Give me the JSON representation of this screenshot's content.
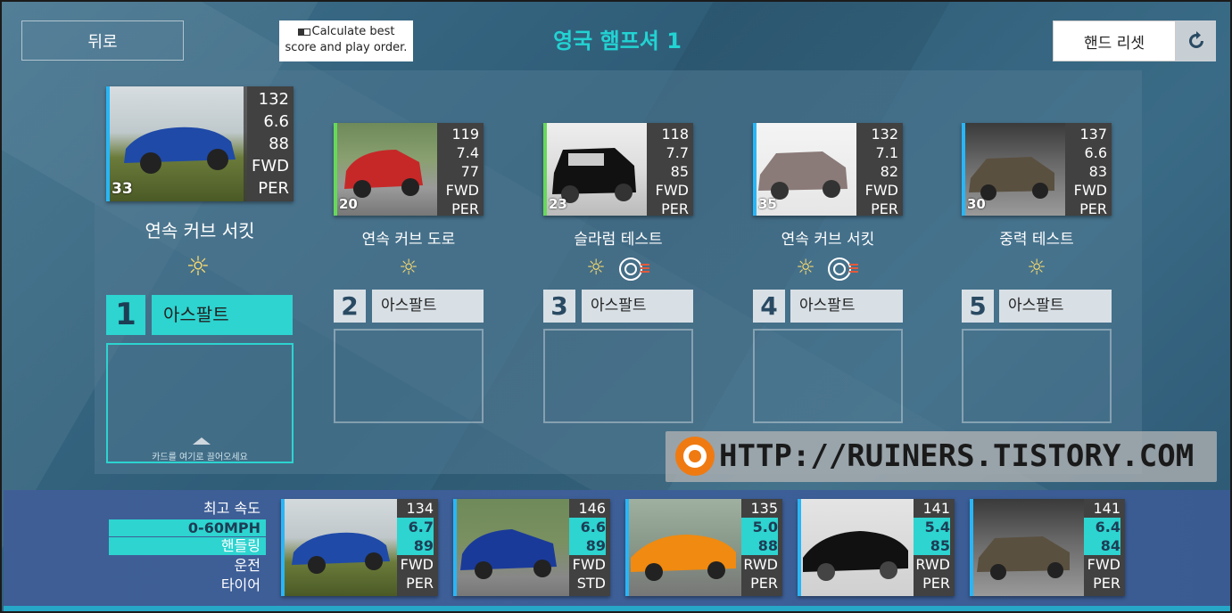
{
  "header": {
    "back_label": "뒤로",
    "calculate_label_1": "Calculate best",
    "calculate_label_2": "score and play order.",
    "title": "영국 햄프셔 1",
    "reset_label": "핸드 리셋"
  },
  "races": [
    {
      "slot": "1",
      "name": "연속 커브 서킷",
      "surface": "아스팔트",
      "weather": "sun-icon",
      "tire_icon": false,
      "card": {
        "rating": "33",
        "top_speed": "132",
        "accel": "6.6",
        "handling": "88",
        "drive": "FWD",
        "tyre": "PER",
        "edge_color": "#29b6f6"
      },
      "drop_hint": "카드를 여기로 끌어오세요"
    },
    {
      "slot": "2",
      "name": "연속 커브 도로",
      "surface": "아스팔트",
      "weather": "sun-icon",
      "tire_icon": false,
      "card": {
        "rating": "20",
        "top_speed": "119",
        "accel": "7.4",
        "handling": "77",
        "drive": "FWD",
        "tyre": "PER",
        "edge_color": "#66d95b"
      }
    },
    {
      "slot": "3",
      "name": "슬라럼 테스트",
      "surface": "아스팔트",
      "weather": "sun-icon",
      "tire_icon": true,
      "card": {
        "rating": "23",
        "top_speed": "118",
        "accel": "7.7",
        "handling": "85",
        "drive": "FWD",
        "tyre": "PER",
        "edge_color": "#66d95b"
      }
    },
    {
      "slot": "4",
      "name": "연속 커브 서킷",
      "surface": "아스팔트",
      "weather": "sun-icon",
      "tire_icon": true,
      "card": {
        "rating": "35",
        "top_speed": "132",
        "accel": "7.1",
        "handling": "82",
        "drive": "FWD",
        "tyre": "PER",
        "edge_color": "#29b6f6"
      }
    },
    {
      "slot": "5",
      "name": "중력 테스트",
      "surface": "아스팔트",
      "weather": "sun-icon",
      "tire_icon": false,
      "card": {
        "rating": "30",
        "top_speed": "137",
        "accel": "6.6",
        "handling": "83",
        "drive": "FWD",
        "tyre": "PER",
        "edge_color": "#29b6f6"
      }
    }
  ],
  "legend": {
    "top_speed": "최고 속도",
    "accel": "0-60MPH",
    "handling": "핸들링",
    "drive": "운전",
    "tyre": "타이어"
  },
  "hand": [
    {
      "top_speed": "134",
      "accel": "6.7",
      "handling": "89",
      "drive": "FWD",
      "tyre": "PER",
      "edge_color": "#29b6f6"
    },
    {
      "top_speed": "146",
      "accel": "6.6",
      "handling": "89",
      "drive": "FWD",
      "tyre": "STD",
      "edge_color": "#29b6f6"
    },
    {
      "top_speed": "135",
      "accel": "5.0",
      "handling": "88",
      "drive": "RWD",
      "tyre": "PER",
      "edge_color": "#29b6f6"
    },
    {
      "top_speed": "141",
      "accel": "5.4",
      "handling": "85",
      "drive": "RWD",
      "tyre": "PER",
      "edge_color": "#29b6f6"
    },
    {
      "top_speed": "141",
      "accel": "6.4",
      "handling": "84",
      "drive": "FWD",
      "tyre": "PER",
      "edge_color": "#29b6f6"
    }
  ],
  "watermark": {
    "text": "HTTP://RUINERS.TISTORY.COM"
  },
  "colors": {
    "accent": "#2dd4d0",
    "title": "#22d3d3",
    "bottom_bar": "#3d5f98"
  }
}
